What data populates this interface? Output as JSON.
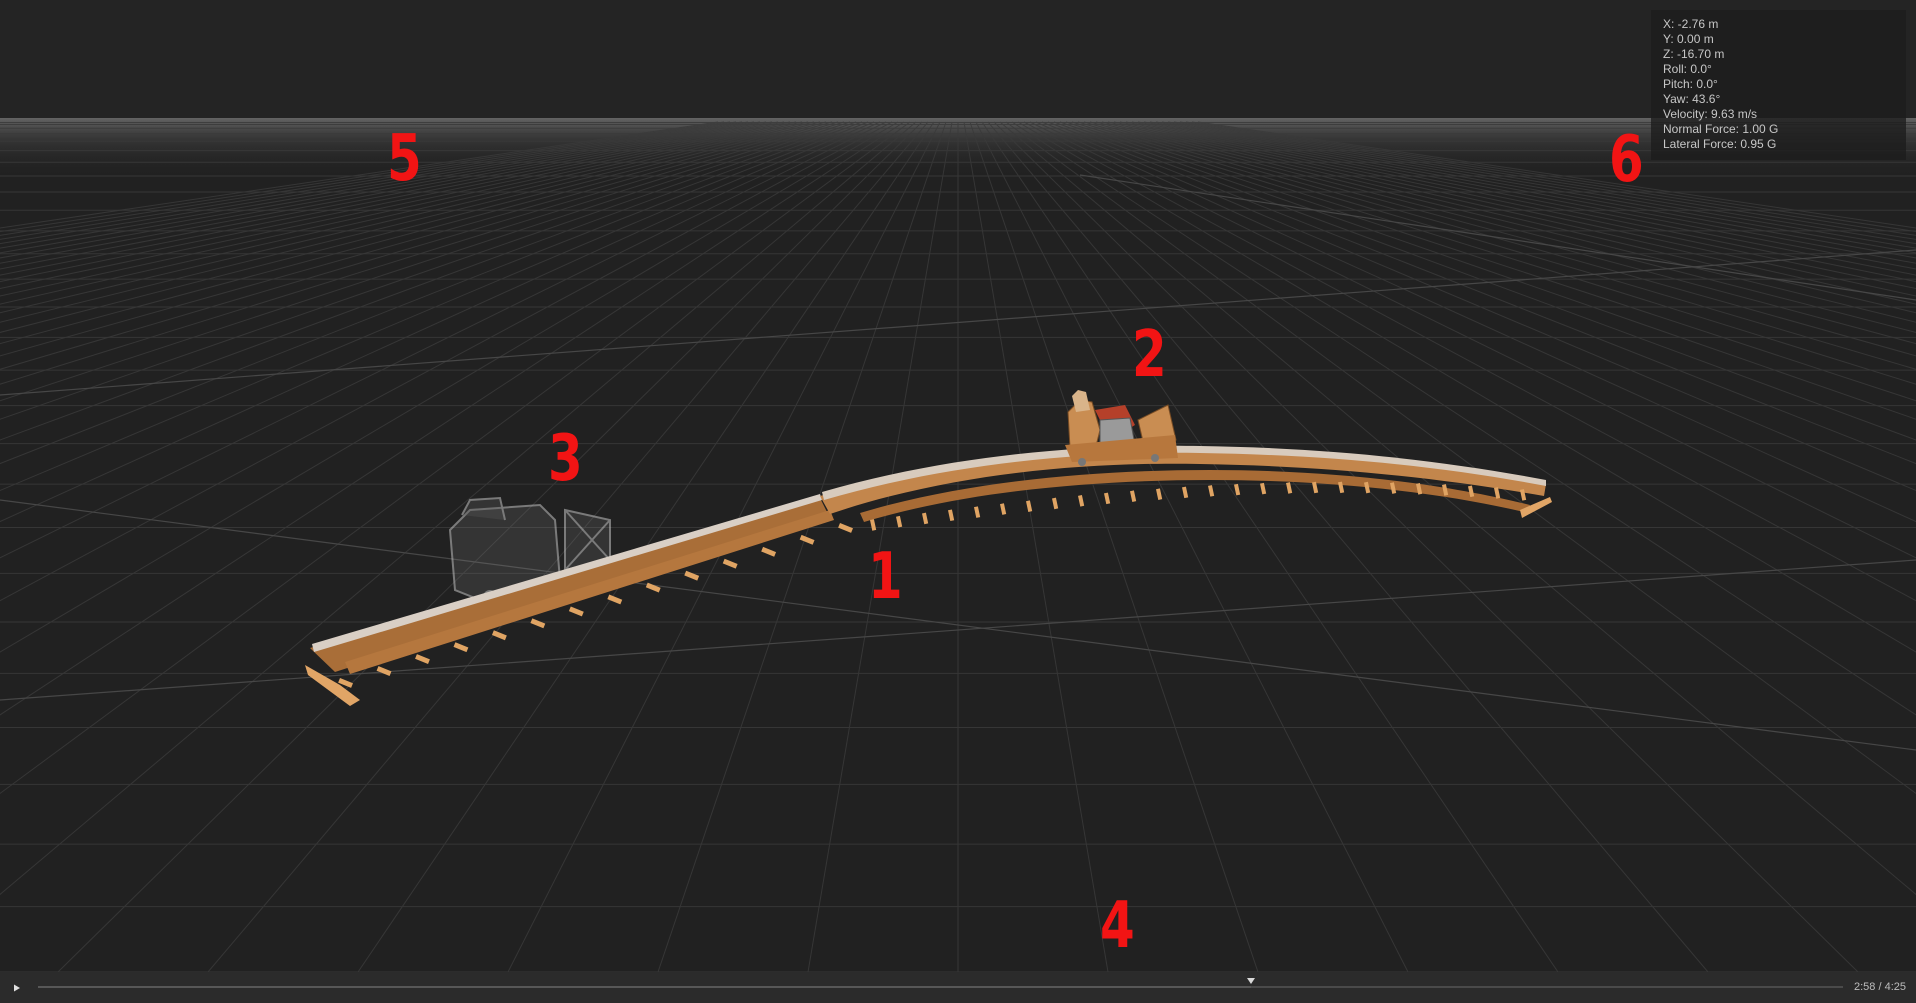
{
  "telemetry": {
    "x": "X: -2.76 m",
    "y": "Y: 0.00 m",
    "z": "Z: -16.70 m",
    "roll": "Roll: 0.0°",
    "pitch": "Pitch: 0.0°",
    "yaw": "Yaw: 43.6°",
    "velocity": "Velocity: 9.63 m/s",
    "normal_force": "Normal Force: 1.00 G",
    "lateral_force": "Lateral Force: 0.95 G"
  },
  "markers": {
    "m1": "1",
    "m2": "2",
    "m3": "3",
    "m4": "4",
    "m5": "5",
    "m6": "6"
  },
  "playback": {
    "play_icon": "play-icon",
    "time": "2:58 / 4:25",
    "progress": 0.672
  },
  "colors": {
    "background": "#212121",
    "track_wood": "#c68a4f",
    "marker_red": "#f21414"
  }
}
